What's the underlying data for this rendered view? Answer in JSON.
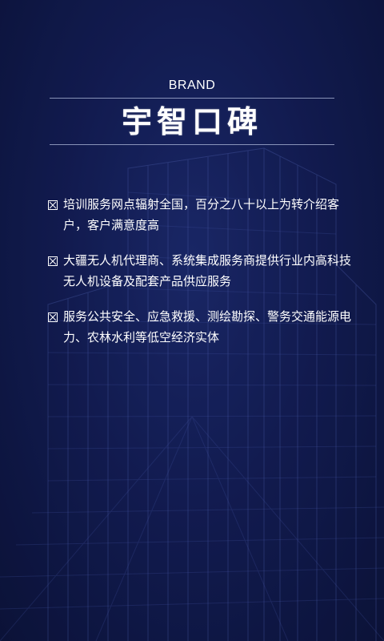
{
  "brand": {
    "label": "BRAND",
    "title": "宇智口碑"
  },
  "items": [
    {
      "text": "培训服务网点辐射全国，百分之八十以上为转介绍客户，客户满意度高"
    },
    {
      "text": "大疆无人机代理商、系统集成服务商提供行业内高科技无人机设备及配套产品供应服务"
    },
    {
      "text": "服务公共安全、应急救援、测绘勘探、警务交通能源电力、农林水利等低空经济实体"
    }
  ],
  "colors": {
    "background": "#131d55",
    "text": "#ffffff",
    "rule": "#c8d2f0"
  },
  "icons": {
    "bullet": "checkbox-x-icon",
    "background": "building-wireframe-icon"
  }
}
